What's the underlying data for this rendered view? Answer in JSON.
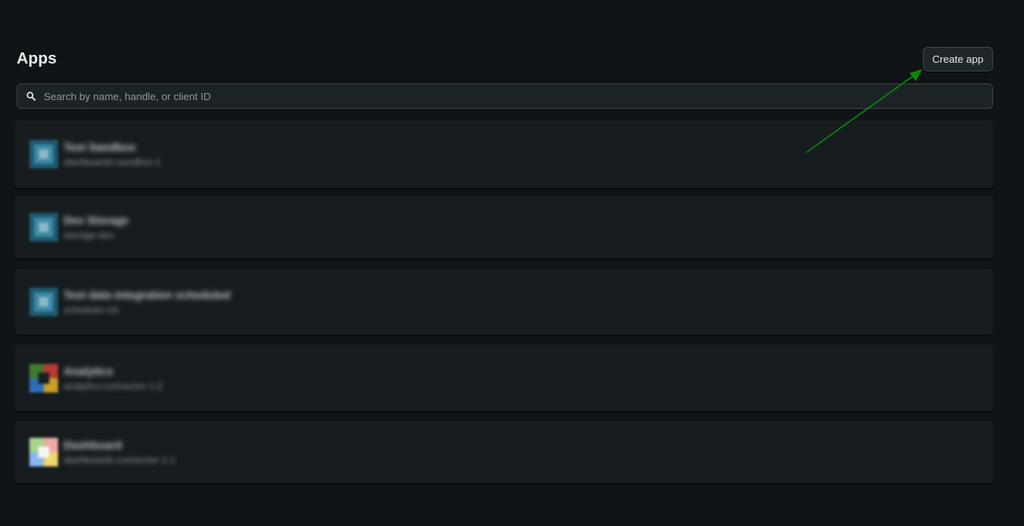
{
  "header": {
    "title": "Apps",
    "create_button_label": "Create app"
  },
  "search": {
    "placeholder": "Search by name, handle, or client ID",
    "value": ""
  },
  "apps": [
    {
      "name": "Test Sandbox",
      "handle": "dashboards-sandbox-1",
      "icon": "blue-app-icon",
      "icon_color": "#2d6f8a"
    },
    {
      "name": "Dev Storage",
      "handle": "storage-dev",
      "icon": "blue-app-icon",
      "icon_color": "#2d6f8a"
    },
    {
      "name": "Test data Integration scheduled",
      "handle": "scheduler-int",
      "icon": "blue-app-icon",
      "icon_color": "#2d6f8a"
    },
    {
      "name": "Analytics",
      "handle": "analytics-connector-1-2",
      "icon": "multicolor-app-icon",
      "icon_color": "#4a7a3a"
    },
    {
      "name": "Dashboard",
      "handle": "dashboards-connector-1-1",
      "icon": "pastel-app-icon",
      "icon_color": "#c9d8a8"
    }
  ],
  "colors": {
    "background": "#101416",
    "card": "#171c1f",
    "annotation_arrow": "#0a8a0a"
  }
}
